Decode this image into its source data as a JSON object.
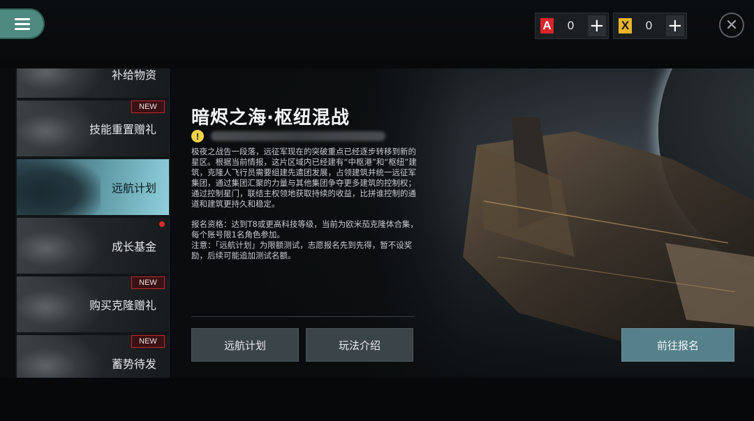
{
  "topbar": {
    "menu_icon": "hamburger-menu-icon",
    "currencies": [
      {
        "icon": "A-currency-icon",
        "glyph": "A",
        "value": "0",
        "color": "#d9262b"
      },
      {
        "icon": "X-currency-icon",
        "glyph": "X",
        "value": "0",
        "color": "#e6b52a"
      }
    ],
    "close_icon": "close-icon"
  },
  "sidebar": {
    "items": [
      {
        "label": "补给物资",
        "badge": ""
      },
      {
        "label": "技能重置赠礼",
        "badge": "NEW"
      },
      {
        "label": "远航计划",
        "badge": "",
        "active": true
      },
      {
        "label": "成长基金",
        "badge": "",
        "red_dot": true
      },
      {
        "label": "购买克隆赠礼",
        "badge": "NEW"
      },
      {
        "label": "蓄势待发",
        "badge": "NEW"
      }
    ]
  },
  "panel": {
    "title": "暗烬之海·枢纽混战",
    "warning_icon": "!",
    "desc_p1": "极夜之战告一段落，远征军现在的突破重点已经逐步转移到新的星区。根据当前情报，这片区域内已经建有“中枢港”和“枢纽”建筑，克隆人飞行员需要组建先遣团发展，占领建筑并统一远征军集团，通过集团汇聚的力量与其他集团争夺更多建筑的控制权；通过控制星门，联结主权领地获取持续的收益，比拼谁控制的通道和建筑更持久和稳定。",
    "desc_p2": "报名资格：达到T8或更高科技等级，当前为欧米茄克隆体合集，每个账号限1名角色参加。",
    "desc_p3": "注意：「远航计划」为限额测试，志愿报名先到先得，暂不设奖励，后续可能追加测试名额。",
    "buttons": {
      "plan": "远航计划",
      "intro": "玩法介绍",
      "register": "前往报名"
    }
  }
}
